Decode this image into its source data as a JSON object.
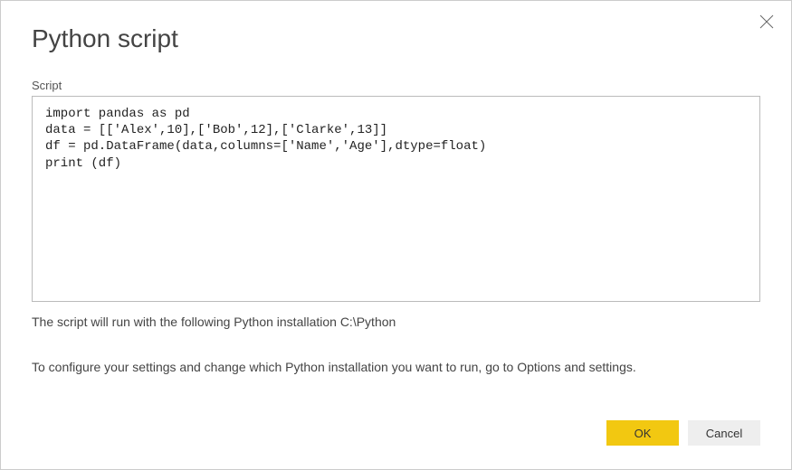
{
  "dialog": {
    "title": "Python script",
    "script_label": "Script",
    "script_content": "import pandas as pd\ndata = [['Alex',10],['Bob',12],['Clarke',13]]\ndf = pd.DataFrame(data,columns=['Name','Age'],dtype=float)\nprint (df)",
    "install_info": "The script will run with the following Python installation C:\\Python",
    "settings_info": "To configure your settings and change which Python installation you want to run, go to Options and settings.",
    "ok_label": "OK",
    "cancel_label": "Cancel"
  },
  "colors": {
    "primary": "#f2c811"
  }
}
